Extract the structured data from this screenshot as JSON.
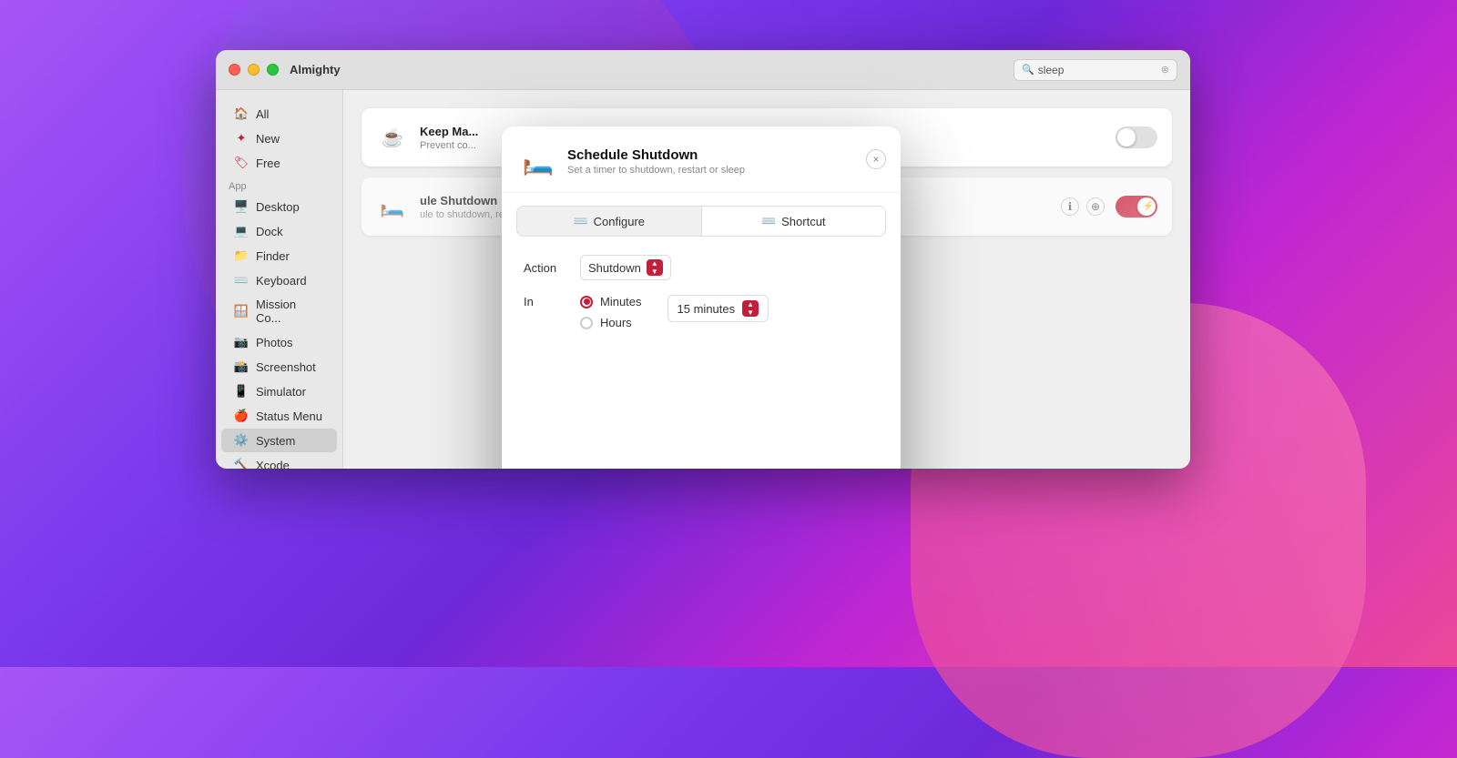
{
  "app": {
    "title": "Almighty",
    "search_placeholder": "sleep",
    "search_query": "sleep"
  },
  "sidebar": {
    "section_app": "App",
    "items_top": [
      {
        "id": "all",
        "label": "All",
        "icon": "🏠",
        "active": false
      },
      {
        "id": "new",
        "label": "New",
        "icon": "✨",
        "active": false
      },
      {
        "id": "free",
        "label": "Free",
        "icon": "🏷️",
        "active": false
      }
    ],
    "items_app": [
      {
        "id": "desktop",
        "label": "Desktop",
        "icon": "🖥️",
        "active": false
      },
      {
        "id": "dock",
        "label": "Dock",
        "icon": "💻",
        "active": false
      },
      {
        "id": "finder",
        "label": "Finder",
        "icon": "📁",
        "active": false
      },
      {
        "id": "keyboard",
        "label": "Keyboard",
        "icon": "⌨️",
        "active": false
      },
      {
        "id": "mission",
        "label": "Mission Co...",
        "icon": "🪟",
        "active": false
      },
      {
        "id": "photos",
        "label": "Photos",
        "icon": "📷",
        "active": false
      },
      {
        "id": "screenshot",
        "label": "Screenshot",
        "icon": "📸",
        "active": false
      },
      {
        "id": "simulator",
        "label": "Simulator",
        "icon": "📱",
        "active": false
      },
      {
        "id": "status_menu",
        "label": "Status Menu",
        "icon": "🍎",
        "active": false
      },
      {
        "id": "system",
        "label": "System",
        "icon": "⚙️",
        "active": true
      },
      {
        "id": "xcode",
        "label": "Xcode",
        "icon": "🔨",
        "active": false
      }
    ]
  },
  "main": {
    "tweaks": [
      {
        "id": "keep-mac-awake",
        "name": "Keep Ma...",
        "desc": "Prevent co...",
        "icon": "☕",
        "enabled": false
      },
      {
        "id": "schedule-shutdown",
        "name": "Schedule Shutdown",
        "desc": "ule to shutdown, restart or sleep",
        "icon": "🛏️",
        "enabled": true
      }
    ]
  },
  "modal": {
    "title": "Schedule Shutdown",
    "subtitle": "Set a timer to shutdown, restart or sleep",
    "icon": "🛏️",
    "tabs": [
      {
        "id": "configure",
        "label": "Configure",
        "icon": "⌨️",
        "active": true
      },
      {
        "id": "shortcut",
        "label": "Shortcut",
        "icon": "⌨️",
        "active": false
      }
    ],
    "action_label": "Action",
    "action_value": "Shutdown",
    "in_label": "In",
    "radio_options": [
      {
        "id": "minutes",
        "label": "Minutes",
        "checked": true
      },
      {
        "id": "hours",
        "label": "Hours",
        "checked": false
      }
    ],
    "duration_value": "15 minutes",
    "close_label": "×"
  },
  "colors": {
    "accent": "#c41e3a",
    "accent_gradient_start": "#c41e3a",
    "accent_gradient_end": "#e63950",
    "sidebar_active": "#d0d0d0"
  }
}
